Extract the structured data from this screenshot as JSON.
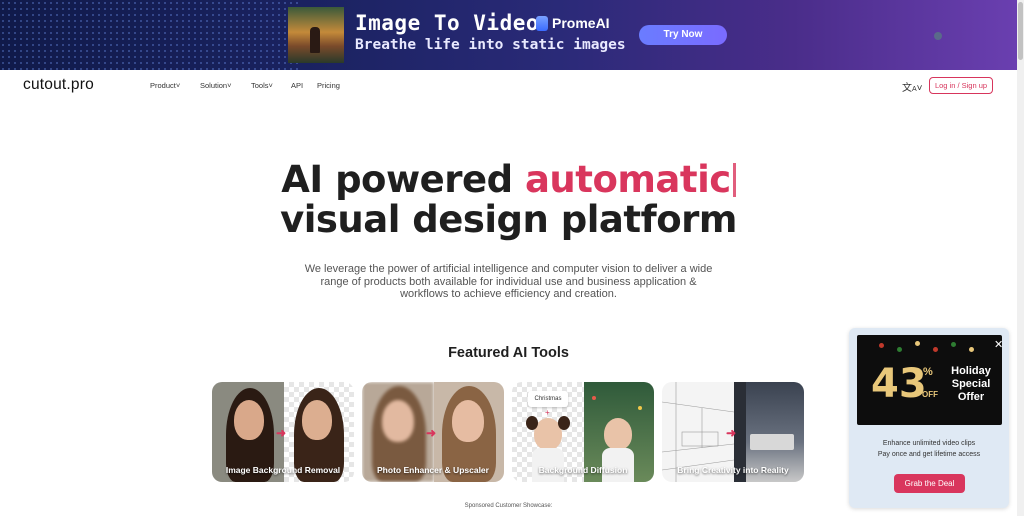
{
  "ad_banner": {
    "title": "Image To Video",
    "subtitle": "Breathe life into static images",
    "brand": "PromeAI",
    "cta_label": "Try Now"
  },
  "nav": {
    "logo": "cutout.pro",
    "items": [
      {
        "label": "Product",
        "has_dropdown": true
      },
      {
        "label": "Solution",
        "has_dropdown": true
      },
      {
        "label": "Tools",
        "has_dropdown": true
      },
      {
        "label": "API",
        "has_dropdown": false
      },
      {
        "label": "Pricing",
        "has_dropdown": false
      }
    ],
    "language_icon": "translate-icon",
    "login_label": "Log in / Sign up"
  },
  "hero": {
    "line1_prefix": "AI powered ",
    "line1_accent": "automatic",
    "line2": "visual design platform",
    "description": "We leverage the power of artificial intelligence and computer vision to deliver a wide range of products both available for individual use and business application & workflows to achieve efficiency and creation.",
    "accent_color": "#d9365d"
  },
  "featured": {
    "heading": "Featured AI Tools",
    "cards": [
      {
        "label": "Image Background Removal"
      },
      {
        "label": "Photo Enhancer & Upscaler"
      },
      {
        "label": "Background Diffusion",
        "tag": "Christmas",
        "plus": "+"
      },
      {
        "label": "Bring Creativity into Reality"
      }
    ]
  },
  "sponsored_text": "Sponsored Customer Showcase:",
  "promo": {
    "discount": "43",
    "percent_sign": "%",
    "off": "OFF",
    "headline": "Holiday Special Offer",
    "line1": "Enhance unlimited video clips",
    "line2": "Pay once and get lifetime access",
    "cta_label": "Grab the Deal",
    "close_icon": "close-icon"
  }
}
